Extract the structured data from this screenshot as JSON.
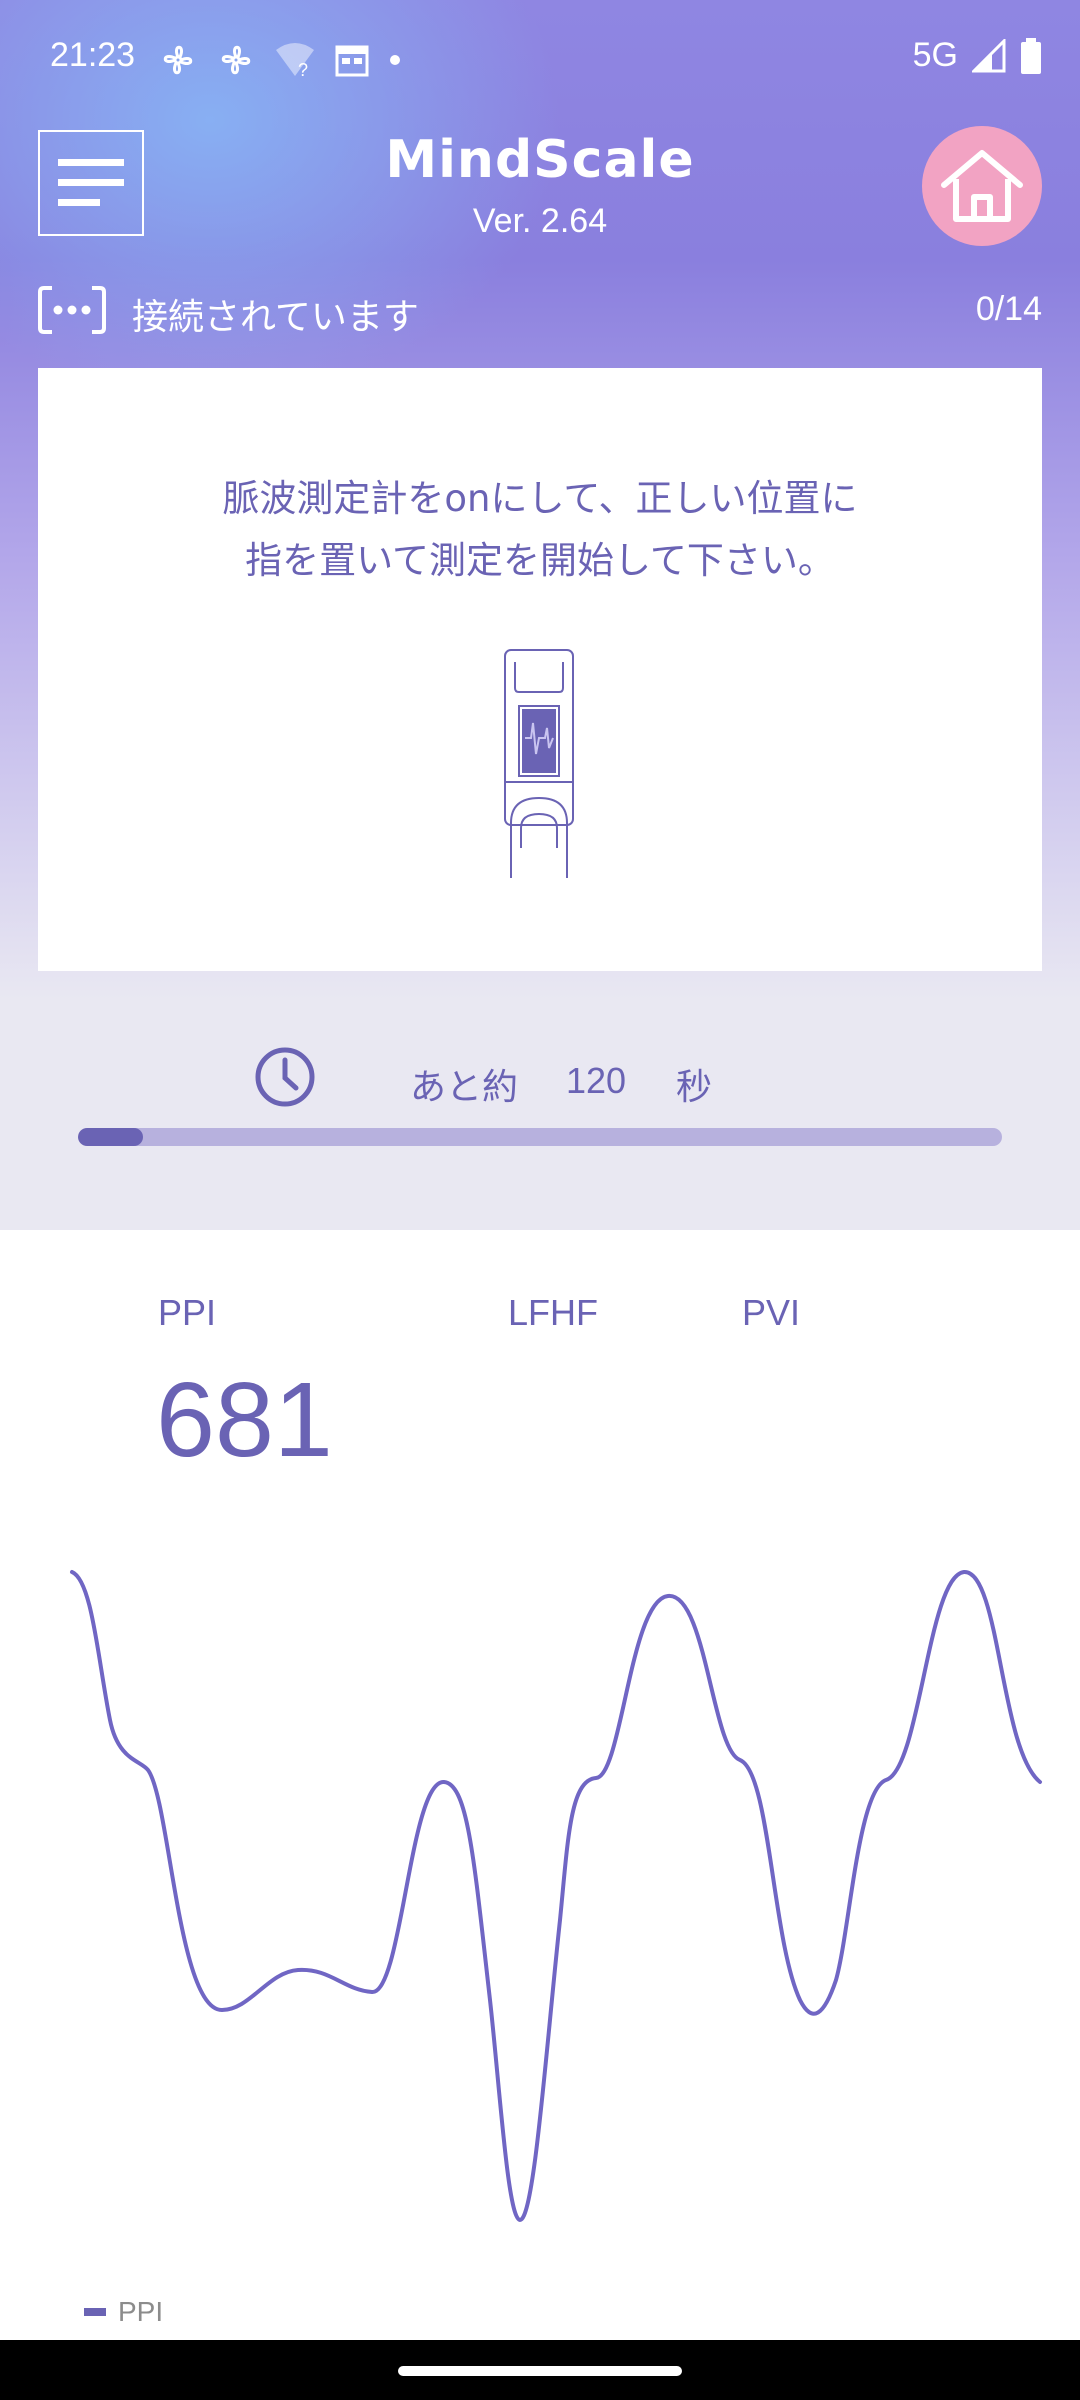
{
  "status_bar": {
    "time": "21:23",
    "network": "5G",
    "icons": [
      "fan-icon",
      "fan-icon",
      "wifi-unknown-icon",
      "calendar-icon",
      "dot-icon",
      "signal-icon",
      "battery-icon"
    ]
  },
  "header": {
    "app_title": "MindScale",
    "version": "Ver. 2.64"
  },
  "connection": {
    "status_text": "接続されています",
    "count": "0/14"
  },
  "instruction": {
    "line1": "脈波測定計をonにして、正しい位置に",
    "line2": "指を置いて測定を開始して下さい。"
  },
  "timer": {
    "prefix": "あと約",
    "value": "120",
    "unit": "秒",
    "progress": 0.07
  },
  "metrics": {
    "ppi_label": "PPI",
    "lfhf_label": "LFHF",
    "pvi_label": "PVI",
    "ppi_value": "681"
  },
  "legend": {
    "label": "PPI"
  },
  "colors": {
    "accent": "#6a63b4",
    "home_button": "#f2a3c3",
    "chart_line": "#7066c4"
  }
}
